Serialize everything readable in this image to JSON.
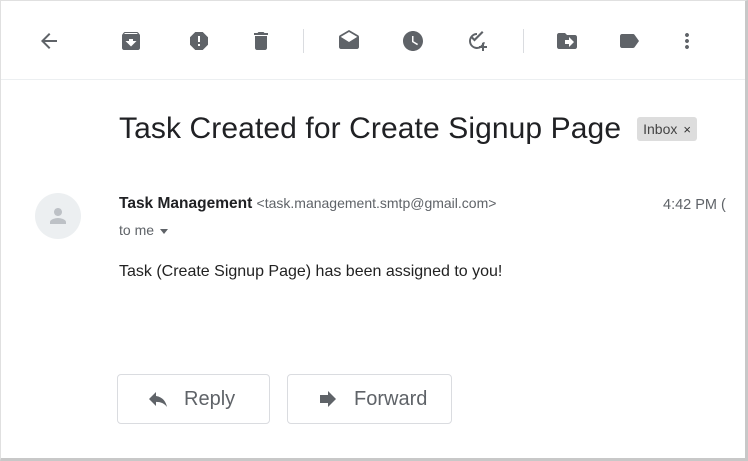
{
  "toolbar": {
    "icons": [
      "back-arrow-icon",
      "archive-icon",
      "report-spam-icon",
      "delete-icon",
      "mark-unread-icon",
      "snooze-icon",
      "add-to-tasks-icon",
      "move-to-icon",
      "label-icon",
      "more-vert-icon"
    ]
  },
  "email": {
    "subject": "Task Created for Create Signup Page",
    "label": "Inbox",
    "label_close": "×",
    "sender_name": "Task Management",
    "sender_email": "<task.management.smtp@gmail.com>",
    "time": "4:42 PM (",
    "to": "to me",
    "body": "Task (Create Signup Page) has been assigned to you!"
  },
  "actions": {
    "reply_label": "Reply",
    "forward_label": "Forward"
  },
  "colors": {
    "icon": "#5f6368",
    "text": "#202124",
    "border": "#dadce0",
    "chip": "#dddddd"
  }
}
